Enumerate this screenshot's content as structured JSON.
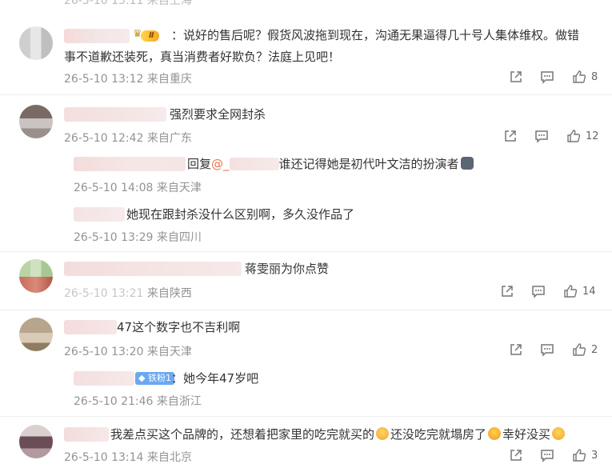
{
  "comments": [
    {
      "text_line1": "：说好的售后呢？假货风波拖到现在，沟通无果逼得几十号人集体维权。做错",
      "text_line2": "事不道歉还装死，真当消费者好欺负？法庭上见吧！",
      "badge": "Ⅱ",
      "date": "26-5-10 13:12",
      "location": "来自重庆",
      "likes": "8"
    },
    {
      "text": "强烈要求全网封杀",
      "date": "26-5-10 12:42",
      "location": "来自广东",
      "likes": "12",
      "replies": [
        {
          "prefix": "回复",
          "mention": "@_",
          "text": "谁还记得她是初代叶文洁的扮演者",
          "date": "26-5-10 14:08",
          "location": "来自天津"
        },
        {
          "text": "她现在跟封杀没什么区别啊，多久没作品了",
          "date": "26-5-10 13:29",
          "location": "来自四川"
        }
      ]
    },
    {
      "text": "蒋雯丽为你点赞",
      "date": "26-5-10 13:21",
      "location": "来自陕西",
      "likes": "14"
    },
    {
      "text": "47这个数字也不吉利啊",
      "date": "26-5-10 13:20",
      "location": "来自天津",
      "likes": "2",
      "replies": [
        {
          "badge": "铁粉1",
          "text": "：她今年47岁吧",
          "date": "26-5-10 21:46",
          "location": "来自浙江"
        }
      ]
    },
    {
      "text_part1": "我差点买这个品牌的，还想着把家里的吃完就买的",
      "text_part2": "还没吃完就塌房了",
      "text_part3": "幸好没买",
      "date": "26-5-10 13:14",
      "location": "来自北京",
      "likes": "3"
    }
  ],
  "icons": {
    "share": "share-icon",
    "comment": "comment-icon",
    "like": "thumbs-up-icon"
  },
  "colors": {
    "mention": "#eb7350",
    "meta": "#939393"
  }
}
